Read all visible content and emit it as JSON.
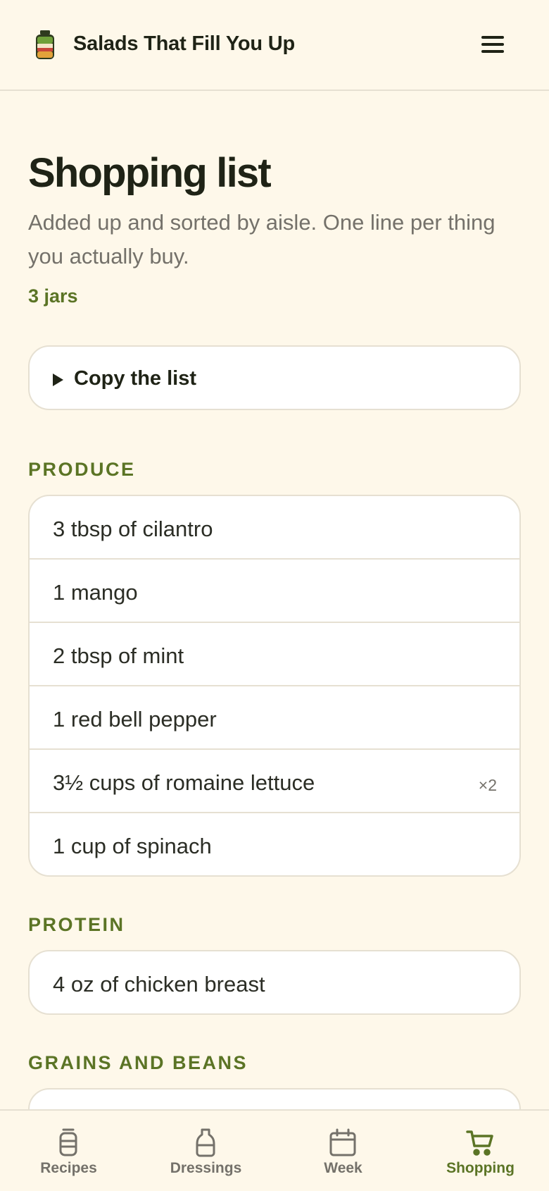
{
  "app": {
    "title": "Salads That Fill You Up",
    "logo_icon": "salad-jar-icon",
    "menu_icon": "hamburger-menu-icon"
  },
  "page": {
    "title": "Shopping list",
    "subtitle": "Added up and sorted by aisle. One line per thing you actually buy.",
    "count": "3 jars"
  },
  "copy_list": {
    "label": "Copy the list",
    "icon": "disclosure-triangle-icon",
    "expanded": false
  },
  "sections": [
    {
      "title": "PRODUCE",
      "items": [
        {
          "text": "3 tbsp of cilantro",
          "mult": ""
        },
        {
          "text": "1 mango",
          "mult": ""
        },
        {
          "text": "2 tbsp of mint",
          "mult": ""
        },
        {
          "text": "1 red bell pepper",
          "mult": ""
        },
        {
          "text": "3½ cups of romaine lettuce",
          "mult": "×2"
        },
        {
          "text": "1 cup of spinach",
          "mult": ""
        }
      ]
    },
    {
      "title": "PROTEIN",
      "items": [
        {
          "text": "4 oz of chicken breast",
          "mult": ""
        }
      ]
    },
    {
      "title": "GRAINS AND BEANS",
      "items": []
    }
  ],
  "nav": {
    "items": [
      {
        "label": "Recipes",
        "icon": "jar-icon",
        "active": false
      },
      {
        "label": "Dressings",
        "icon": "bottle-icon",
        "active": false
      },
      {
        "label": "Week",
        "icon": "calendar-icon",
        "active": false
      },
      {
        "label": "Shopping",
        "icon": "shopping-cart-icon",
        "active": true
      }
    ]
  },
  "colors": {
    "background": "#FEF8EA",
    "accent": "#5B7425",
    "text": "#1F2316",
    "muted": "#74716A",
    "border": "#E6E0D2"
  }
}
